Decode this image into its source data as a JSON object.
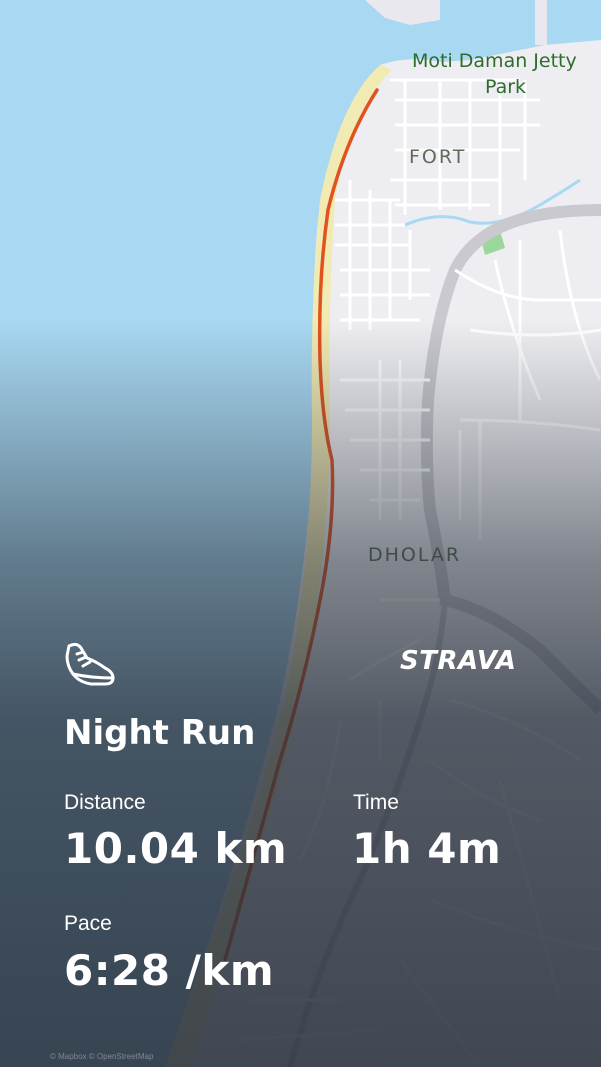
{
  "map": {
    "labels": {
      "poi": "Moti Daman Jetty\nPark",
      "fort": "FORT",
      "dholar": "DHOLAR"
    },
    "colors": {
      "sea": "#a8d8f2",
      "land": "#eeeef2",
      "beach": "#f2eab3",
      "route": "#e0521f",
      "road": "#ffffff",
      "major_road": "#c9c9cf",
      "park": "#9ad79a"
    },
    "attribution": "© Mapbox © OpenStreetMap"
  },
  "activity": {
    "icon": "running-shoe-icon",
    "brand": "STRAVA",
    "title": "Night Run",
    "stats": {
      "distance_label": "Distance",
      "distance_value": "10.04 km",
      "time_label": "Time",
      "time_value": "1h 4m",
      "pace_label": "Pace",
      "pace_value": "6:28 /km"
    }
  }
}
